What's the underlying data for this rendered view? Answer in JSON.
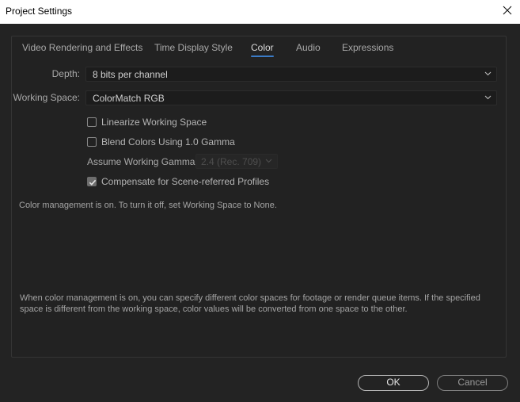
{
  "window": {
    "title": "Project Settings",
    "close_icon": "close-x-icon"
  },
  "tabs": [
    {
      "label": "Video Rendering and Effects",
      "active": false
    },
    {
      "label": "Time Display Style",
      "active": false
    },
    {
      "label": "Color",
      "active": true
    },
    {
      "label": "Audio",
      "active": false
    },
    {
      "label": "Expressions",
      "active": false
    }
  ],
  "colors": {
    "accent": "#3b7bc6",
    "background": "#232323",
    "titlebar": "#ffffff"
  },
  "fields": {
    "depth": {
      "label": "Depth:",
      "value": "8 bits per channel"
    },
    "working_space": {
      "label": "Working Space:",
      "value": "ColorMatch RGB"
    }
  },
  "checkboxes": [
    {
      "label": "Linearize Working Space",
      "checked": false
    },
    {
      "label": "Blend Colors Using 1.0 Gamma",
      "checked": false
    }
  ],
  "gamma": {
    "label": "Assume Working Gamma:",
    "value": "2.4 (Rec. 709)",
    "disabled": true
  },
  "compensate": {
    "label": "Compensate for Scene-referred Profiles",
    "checked": true
  },
  "status_note": "Color management is on. To turn it off, set Working Space to None.",
  "info_note": "When color management is on, you can specify different color spaces for footage or render queue items. If the specified space is different from the working space, color values will be converted from one space to the other.",
  "buttons": {
    "ok": "OK",
    "cancel": "Cancel"
  }
}
